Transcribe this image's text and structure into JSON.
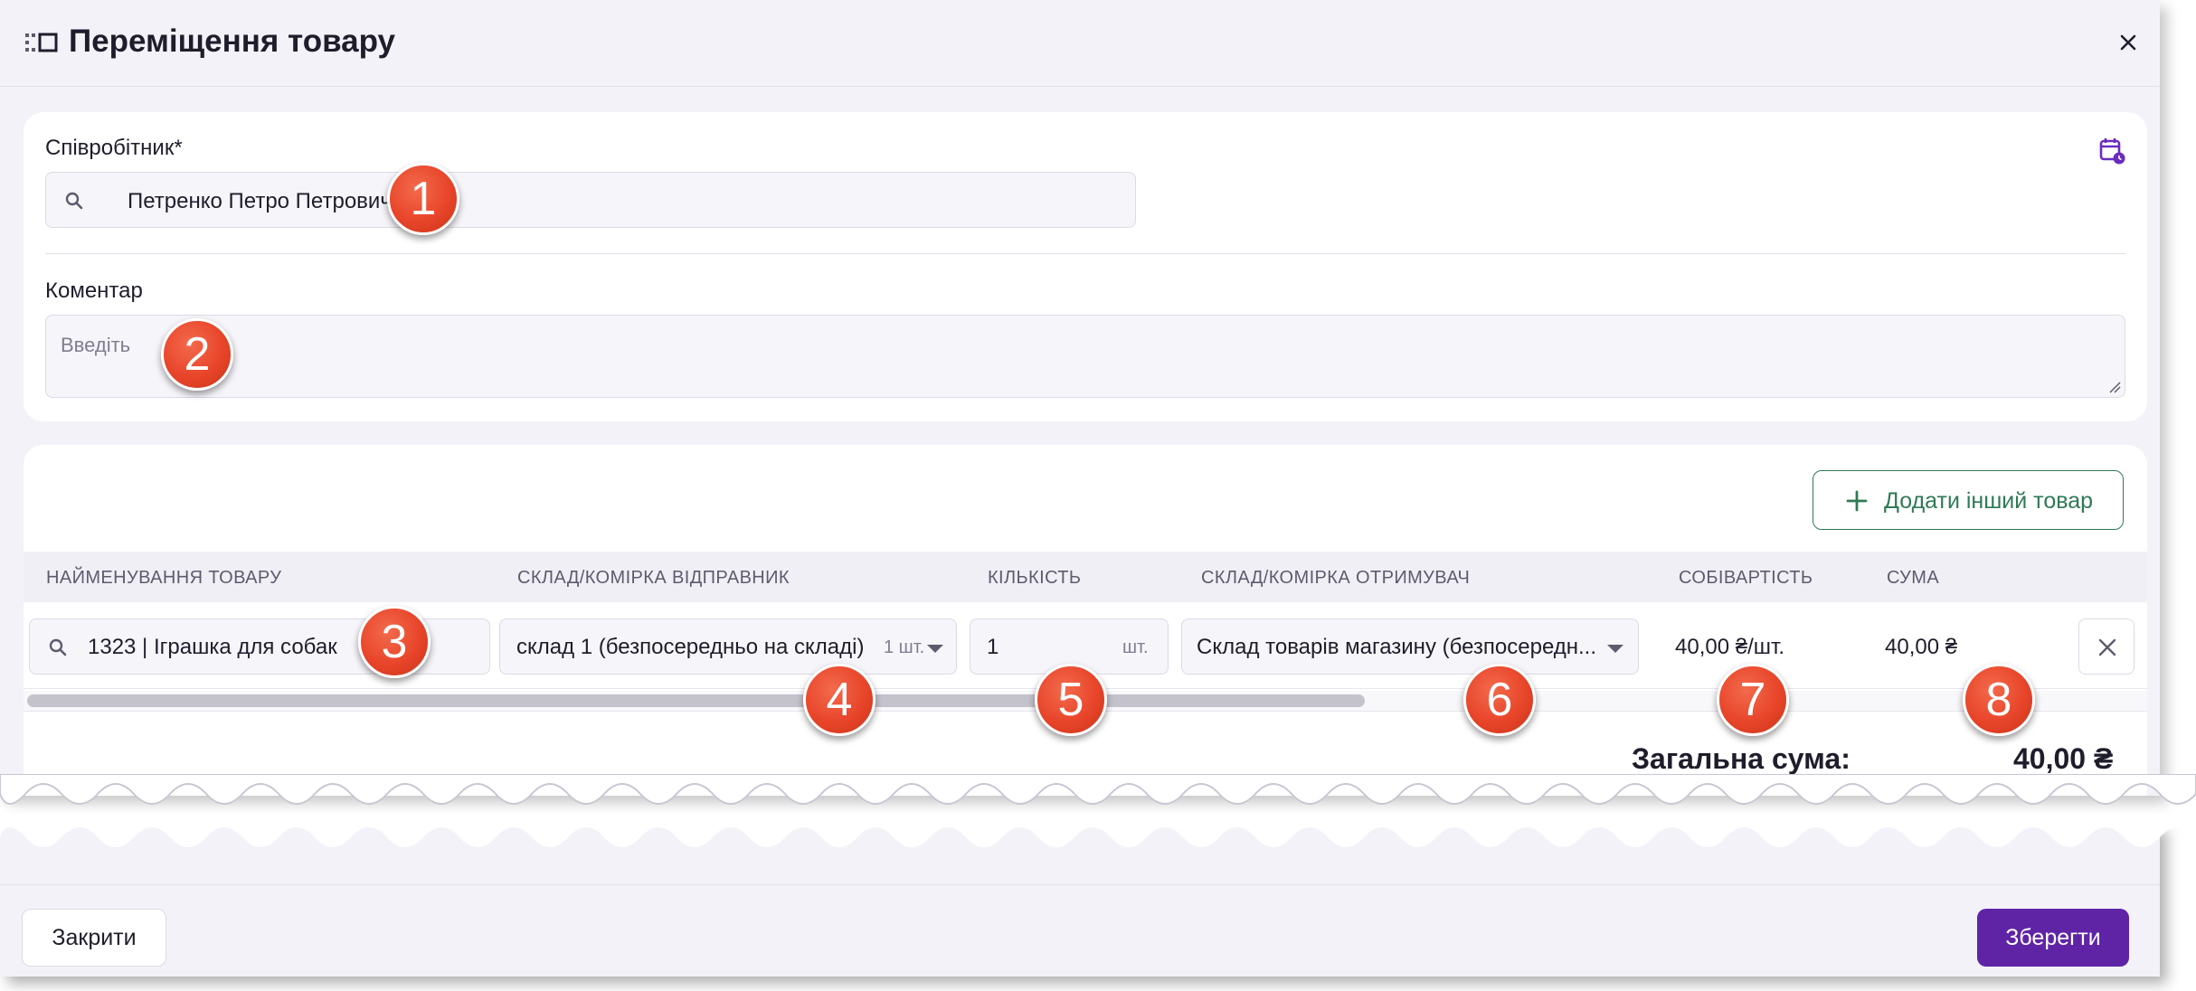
{
  "dialog": {
    "title": "Переміщення товару"
  },
  "form": {
    "employee": {
      "label": "Співробітник*",
      "value": "Петренко Петро Петрович"
    },
    "comment": {
      "label": "Коментар",
      "placeholder": "Введіть"
    }
  },
  "products": {
    "add_button_label": "Додати інший товар",
    "columns": [
      "НАЙМЕНУВАННЯ ТОВАРУ",
      "СКЛАД/КОМІРКА ВІДПРАВНИК",
      "КІЛЬКІСТЬ",
      "СКЛАД/КОМІРКА ОТРИМУВАЧ",
      "СОБІВАРТІСТЬ",
      "СУМА"
    ],
    "rows": [
      {
        "product": "1323 | Іграшка для собак",
        "sender": "склад 1 (безпосередньо на складі)",
        "sender_stock": "1 шт.",
        "quantity": "1",
        "quantity_unit": "шт.",
        "receiver": "Склад товарів магазину (безпосередн...",
        "cost": "40,00 ₴/шт.",
        "sum": "40,00 ₴"
      }
    ],
    "scroll_position": 0.63,
    "total_label": "Загальна сума:",
    "total_value": "40,00 ₴"
  },
  "footer": {
    "close_label": "Закрити",
    "save_label": "Зберегти"
  },
  "callouts": [
    "1",
    "2",
    "3",
    "4",
    "5",
    "6",
    "7",
    "8"
  ],
  "colors": {
    "background": "#f3f2f8",
    "card": "#ffffff",
    "accent_green": "#2f7a55",
    "primary_purple": "#5f24a6",
    "calendar_icon": "#6a2cc0",
    "callout": "#e8452a"
  },
  "icons": {
    "header": "drag-handle-icon",
    "close": "close-icon",
    "calendar": "calendar-clock-icon",
    "search": "search-icon",
    "add": "plus-icon",
    "dropdown": "chevron-down-icon",
    "delete": "close-icon"
  }
}
